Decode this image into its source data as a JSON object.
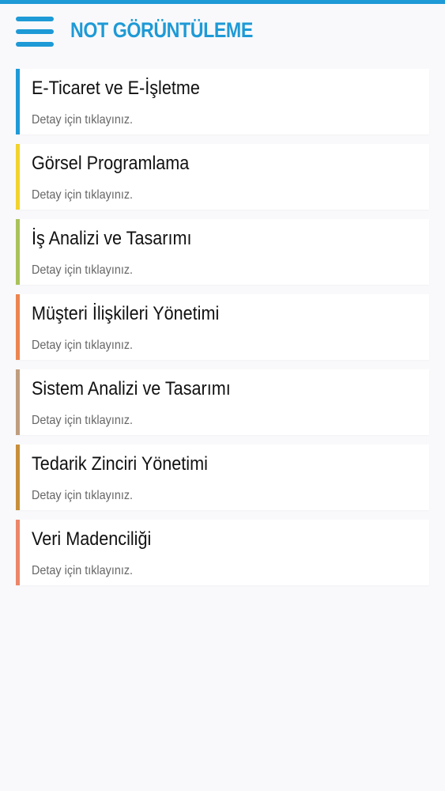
{
  "colors": {
    "accent": "#1e9ad6"
  },
  "header": {
    "title": "NOT GÖRÜNTÜLEME",
    "menu_icon": "hamburger-menu-icon"
  },
  "courses": [
    {
      "title": "E-Ticaret ve E-İşletme",
      "subtitle": "Detay için tıklayınız.",
      "color": "#1e9ad6"
    },
    {
      "title": "Görsel Programlama",
      "subtitle": "Detay için tıklayınız.",
      "color": "#f2d22e"
    },
    {
      "title": "İş Analizi ve Tasarımı",
      "subtitle": "Detay için tıklayınız.",
      "color": "#a9c25a"
    },
    {
      "title": "Müşteri İlişkileri Yönetimi",
      "subtitle": "Detay için tıklayınız.",
      "color": "#ec8550"
    },
    {
      "title": "Sistem Analizi ve Tasarımı",
      "subtitle": "Detay için tıklayınız.",
      "color": "#bf9e7e"
    },
    {
      "title": "Tedarik Zinciri Yönetimi",
      "subtitle": "Detay için tıklayınız.",
      "color": "#c88f3a"
    },
    {
      "title": "Veri Madenciliği",
      "subtitle": "Detay için tıklayınız.",
      "color": "#ec8669"
    }
  ]
}
